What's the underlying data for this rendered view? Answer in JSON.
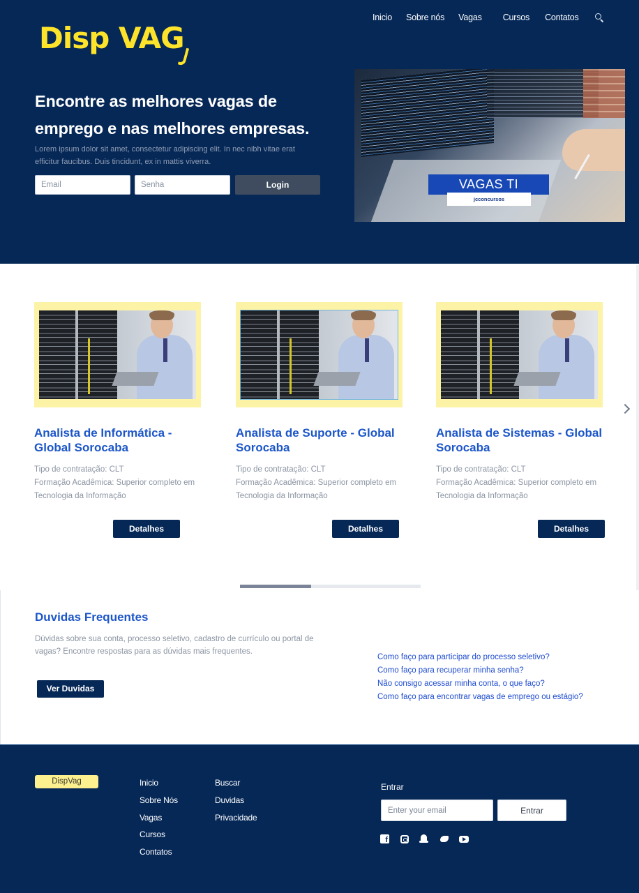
{
  "brand": {
    "logo_text": "Disp VAG"
  },
  "nav": {
    "items": [
      {
        "label": "Inicio"
      },
      {
        "label": "Sobre nós"
      },
      {
        "label": "Vagas"
      },
      {
        "label": "Cursos"
      },
      {
        "label": "Contatos"
      }
    ],
    "search_icon": "search-icon"
  },
  "hero": {
    "title": "Encontre as melhores vagas de emprego e nas melhores empresas.",
    "text": "Lorem ipsum dolor sit amet, consectetur adipiscing elit. In nec nibh vitae erat efficitur faucibus. Duis tincidunt, ex in mattis viverra.",
    "email_placeholder": "Email",
    "password_placeholder": "Senha",
    "login_label": "Login",
    "image_badge": "VAGAS TI",
    "image_badge_sub": "jcconcursos"
  },
  "jobs": {
    "cards": [
      {
        "title": "Analista de Informática - Global Sorocaba",
        "contract": "Tipo de contratação: CLT",
        "education": "Formação Acadêmica: Superior completo em Tecnologia da Informação",
        "button": "Detalhes"
      },
      {
        "title": "Analista de Suporte - Global Sorocaba",
        "contract": "Tipo de contratação: CLT",
        "education": "Formação Acadêmica: Superior completo em Tecnologia da Informação",
        "button": "Detalhes"
      },
      {
        "title": "Analista de Sistemas - Global Sorocaba",
        "contract": "Tipo de contratação: CLT",
        "education": "Formação Acadêmica: Superior completo em Tecnologia da Informação",
        "button": "Detalhes"
      }
    ],
    "next_icon": "chevron-right-icon"
  },
  "faq": {
    "title": "Duvidas Frequentes",
    "text": "Dúvidas sobre sua conta, processo seletivo, cadastro de currículo ou portal de vagas? Encontre respostas para as dúvidas mais frequentes.",
    "button": "Ver Duvidas",
    "links": [
      "Como faço para participar do processo seletivo?",
      "Como faço para recuperar minha senha?",
      "Não consigo acessar minha conta, o que faço?",
      "Como faço para encontrar vagas de emprego ou estágio?"
    ]
  },
  "footer": {
    "logo": "DispVag",
    "col1": [
      "Inicio",
      "Sobre Nós",
      "Vagas",
      "Cursos",
      "Contatos"
    ],
    "col2": [
      "Buscar",
      "Duvidas",
      "Privacidade"
    ],
    "signin_label": "Entrar",
    "email_placeholder": "Enter your email",
    "signin_button": "Entrar",
    "social": [
      "facebook-icon",
      "instagram-icon",
      "snapchat-icon",
      "twitter-icon",
      "youtube-icon"
    ]
  },
  "colors": {
    "navy": "#062857",
    "accent_yellow": "#fde32a",
    "card_frame": "#fdf3a6",
    "title_blue": "#1c56c8",
    "link_blue": "#1d4bd0"
  }
}
